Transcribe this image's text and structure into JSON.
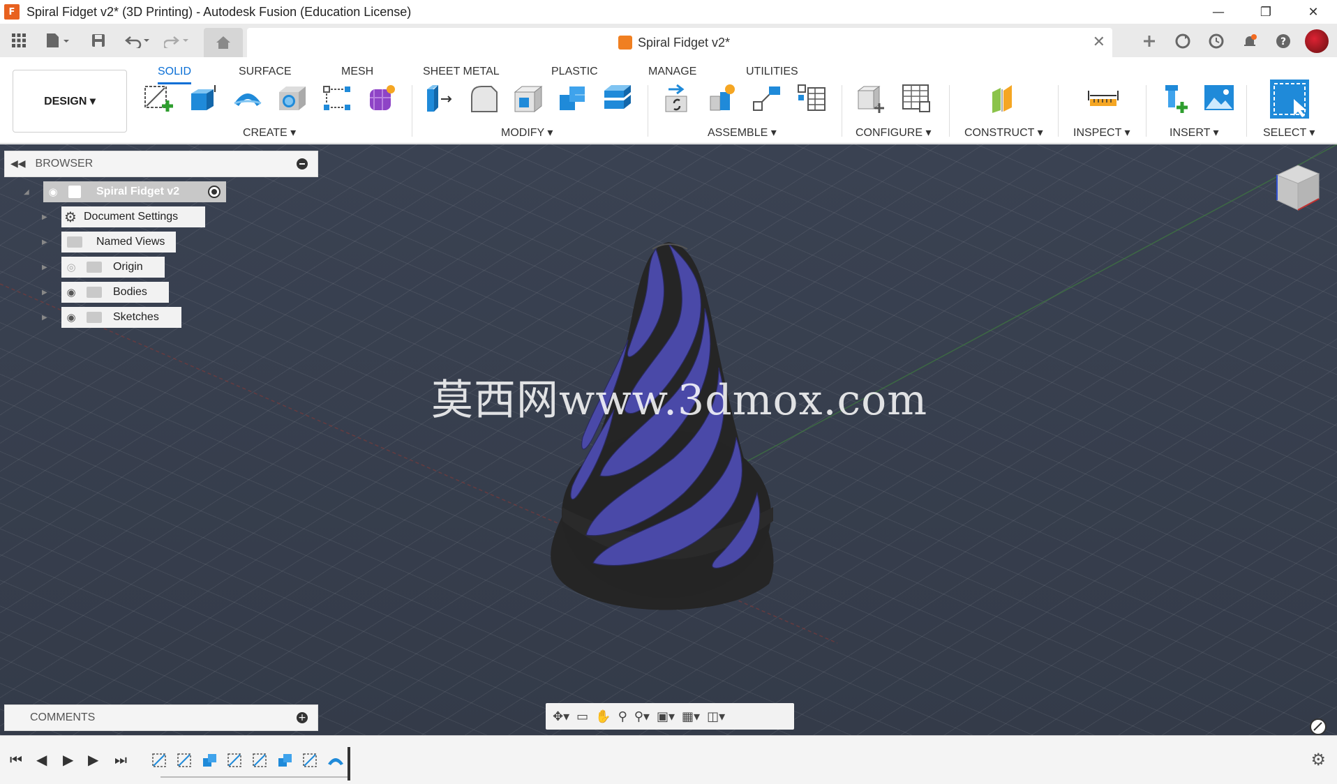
{
  "window": {
    "app_logo": "F",
    "title": "Spiral Fidget v2* (3D Printing) - Autodesk Fusion (Education License)",
    "minimize": "—",
    "restore": "❐",
    "close": "✕"
  },
  "document_tab": {
    "title": "Spiral Fidget v2*",
    "close": "✕"
  },
  "ribbon": {
    "workspace_button": "DESIGN ▾",
    "tabs": [
      "SOLID",
      "SURFACE",
      "MESH",
      "SHEET METAL",
      "PLASTIC",
      "MANAGE",
      "UTILITIES"
    ],
    "active_tab": "SOLID",
    "groups": [
      "CREATE ▾",
      "MODIFY ▾",
      "ASSEMBLE ▾",
      "CONFIGURE ▾",
      "CONSTRUCT ▾",
      "INSPECT ▾",
      "INSERT ▾",
      "SELECT ▾"
    ]
  },
  "browser": {
    "title": "BROWSER",
    "root": "Spiral Fidget v2",
    "items": [
      "Document Settings",
      "Named Views",
      "Origin",
      "Bodies",
      "Sketches"
    ]
  },
  "comments": {
    "title": "COMMENTS"
  },
  "viewport": {
    "watermark": "莫西网www.3dmox.com",
    "model_colors": {
      "stripe": "#4a49a8",
      "body": "#262626"
    }
  },
  "icons": {
    "quick_access": [
      "apps-grid-icon",
      "file-icon",
      "save-icon",
      "undo-icon",
      "redo-icon",
      "home-icon"
    ],
    "top_right": [
      "new-tab-icon",
      "sync-icon",
      "history-icon",
      "notifications-icon",
      "help-icon",
      "user-avatar"
    ],
    "navbar": [
      "orbit-icon",
      "look-at-icon",
      "pan-icon",
      "zoom-icon",
      "fit-icon",
      "display-settings-icon",
      "grid-settings-icon",
      "viewports-icon"
    ],
    "timeline": [
      "go-start-icon",
      "step-back-icon",
      "play-icon",
      "step-forward-icon",
      "go-end-icon"
    ]
  }
}
